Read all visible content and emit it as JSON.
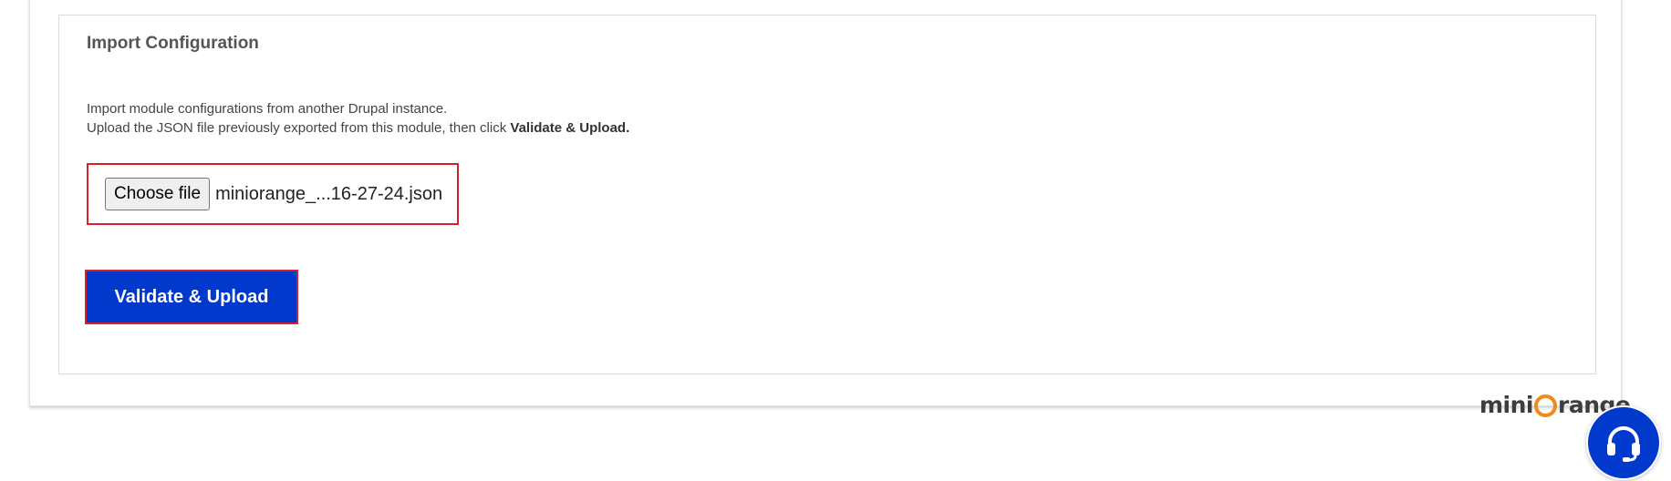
{
  "import_config": {
    "title": "Import Configuration",
    "description_line1": "Import module configurations from another Drupal instance.",
    "description_line2_prefix": "Upload the JSON file previously exported from this module, then click ",
    "description_line2_bold": "Validate & Upload.",
    "choose_file_label": "Choose file",
    "file_name": "miniorange_...16-27-24.json",
    "upload_button_label": "Validate & Upload"
  },
  "branding": {
    "logo_text_left": "mini",
    "logo_text_right": "range",
    "logo_accent_color": "#f08a1c"
  },
  "support": {
    "icon": "headset-icon"
  },
  "colors": {
    "primary_button": "#0039cc",
    "highlight_border": "#d8202a"
  }
}
